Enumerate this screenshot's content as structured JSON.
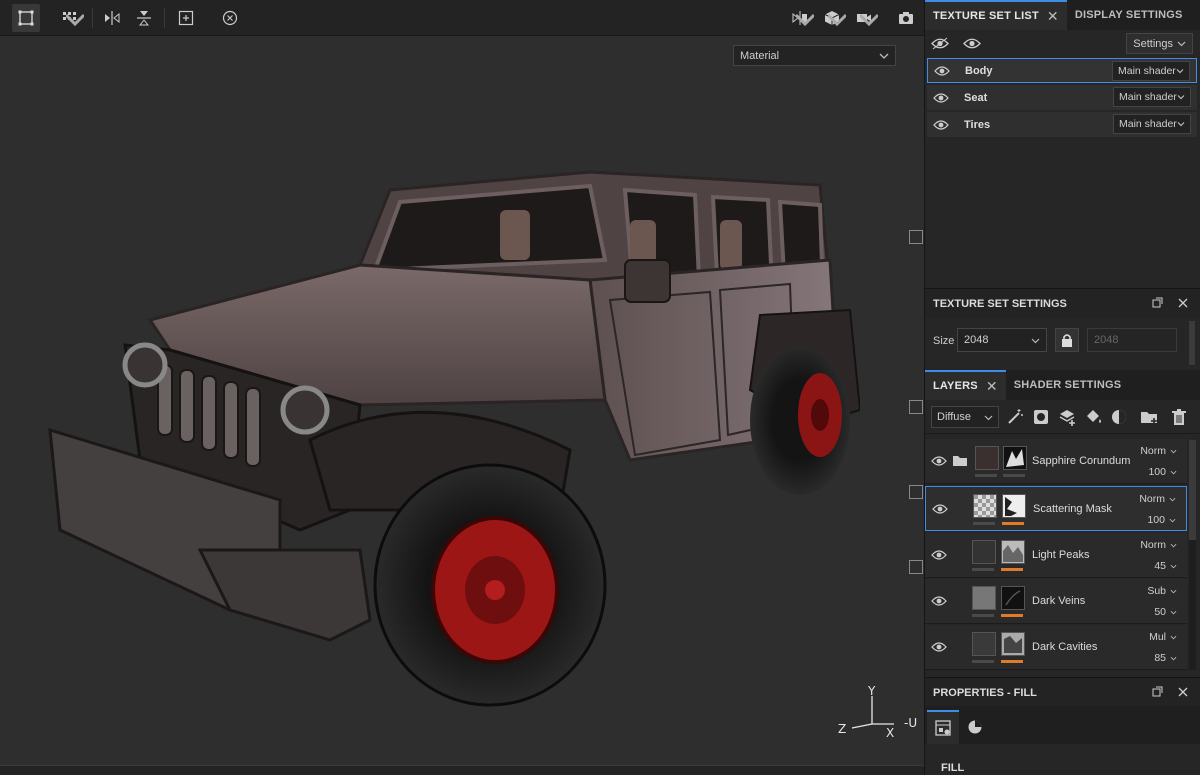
{
  "viewport": {
    "material_dropdown": "Material",
    "axes": {
      "x": "X",
      "y": "Y",
      "z": "Z",
      "neg_u": "-U"
    }
  },
  "texture_set_list": {
    "tab_label": "TEXTURE SET LIST",
    "other_tab_label": "DISPLAY SETTINGS",
    "settings_button": "Settings",
    "sets": [
      {
        "name": "Body",
        "shader": "Main shader",
        "selected": true
      },
      {
        "name": "Seat",
        "shader": "Main shader",
        "selected": false
      },
      {
        "name": "Tires",
        "shader": "Main shader",
        "selected": false
      }
    ]
  },
  "texture_set_settings": {
    "title": "TEXTURE SET SETTINGS",
    "size_label": "Size",
    "size_value": "2048",
    "size_linked_value": "2048"
  },
  "layers_panel": {
    "tab_label": "LAYERS",
    "other_tab_label": "SHADER SETTINGS",
    "channel": "Diffuse",
    "layers": [
      {
        "name": "Sapphire Corundum",
        "blend": "Norm",
        "opacity": "100",
        "folder": true,
        "selected": false
      },
      {
        "name": "Scattering Mask",
        "blend": "Norm",
        "opacity": "100",
        "folder": false,
        "selected": true
      },
      {
        "name": "Light Peaks",
        "blend": "Norm",
        "opacity": "45",
        "folder": false,
        "selected": false
      },
      {
        "name": "Dark Veins",
        "blend": "Sub",
        "opacity": "50",
        "folder": false,
        "selected": false
      },
      {
        "name": "Dark Cavities",
        "blend": "Mul",
        "opacity": "85",
        "folder": false,
        "selected": false
      }
    ]
  },
  "properties": {
    "title": "PROPERTIES - FILL",
    "section": "FILL"
  },
  "colors": {
    "accent": "#3d8ee6",
    "mask_bar": "#e07b2a",
    "panel_bg": "#262626",
    "viewport_bg": "#2e2e2e"
  },
  "icons": [
    "select-tool-icon",
    "grid-icon",
    "mirror-x-icon",
    "mirror-y-icon",
    "fit-icon",
    "reset-icon",
    "split-view-icon",
    "cube-icon",
    "camera-icon",
    "screenshot-icon"
  ]
}
